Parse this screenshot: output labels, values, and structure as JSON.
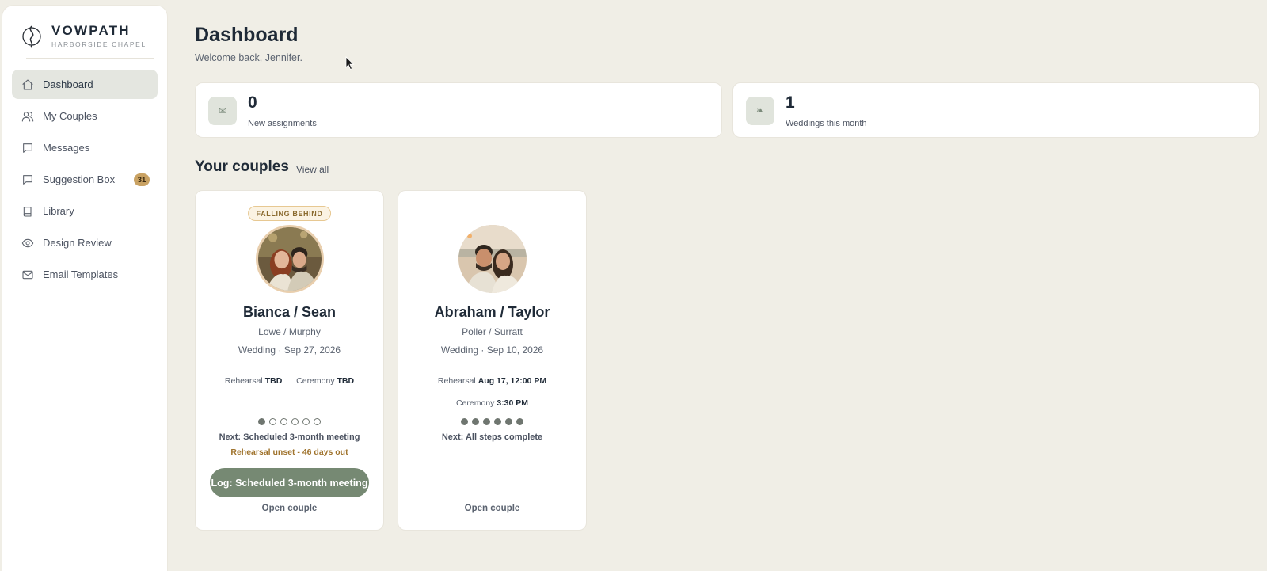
{
  "brand": {
    "name": "VOWPATH",
    "subtitle": "HARBORSIDE CHAPEL"
  },
  "sidebar": {
    "items": [
      {
        "label": "Dashboard",
        "icon": "home-icon",
        "active": true
      },
      {
        "label": "My Couples",
        "icon": "users-icon"
      },
      {
        "label": "Messages",
        "icon": "message-icon"
      },
      {
        "label": "Suggestion Box",
        "icon": "message-icon",
        "badge": "31"
      },
      {
        "label": "Library",
        "icon": "book-icon"
      },
      {
        "label": "Design Review",
        "icon": "eye-icon"
      },
      {
        "label": "Email Templates",
        "icon": "mail-icon"
      }
    ]
  },
  "header": {
    "title": "Dashboard",
    "subtitle": "Welcome back, Jennifer."
  },
  "stats": [
    {
      "value": "0",
      "label": "New assignments",
      "icon": "envelope-icon",
      "glyph": "✉"
    },
    {
      "value": "1",
      "label": "Weddings this month",
      "icon": "leaf-icon",
      "glyph": "❧"
    }
  ],
  "couples_section": {
    "title": "Your couples",
    "view_all": "View all"
  },
  "couples": [
    {
      "status": "FALLING BEHIND",
      "name": "Bianca / Sean",
      "surnames": "Lowe / Murphy",
      "wedding": "Wedding · Sep 27, 2026",
      "rehearsal_label": "Rehearsal",
      "rehearsal_value": "TBD",
      "ceremony_label": "Ceremony",
      "ceremony_value": "TBD",
      "steps_completed": 1,
      "steps_total": 6,
      "next": "Next: Scheduled 3-month meeting",
      "warning": "Rehearsal unset - 46 days out",
      "log_button": "Log: Scheduled 3-month meeting",
      "open": "Open couple"
    },
    {
      "name": "Abraham / Taylor",
      "surnames": "Poller / Surratt",
      "wedding": "Wedding · Sep 10, 2026",
      "rehearsal_label": "Rehearsal",
      "rehearsal_value": "Aug 17, 12:00 PM",
      "ceremony_label": "Ceremony",
      "ceremony_value": "3:30 PM",
      "steps_completed": 6,
      "steps_total": 6,
      "next": "Next: All steps complete",
      "open": "Open couple"
    }
  ],
  "colors": {
    "accent": "#768973",
    "warning": "#a0742e",
    "badge": "#c9a263",
    "background": "#f0eee6"
  }
}
